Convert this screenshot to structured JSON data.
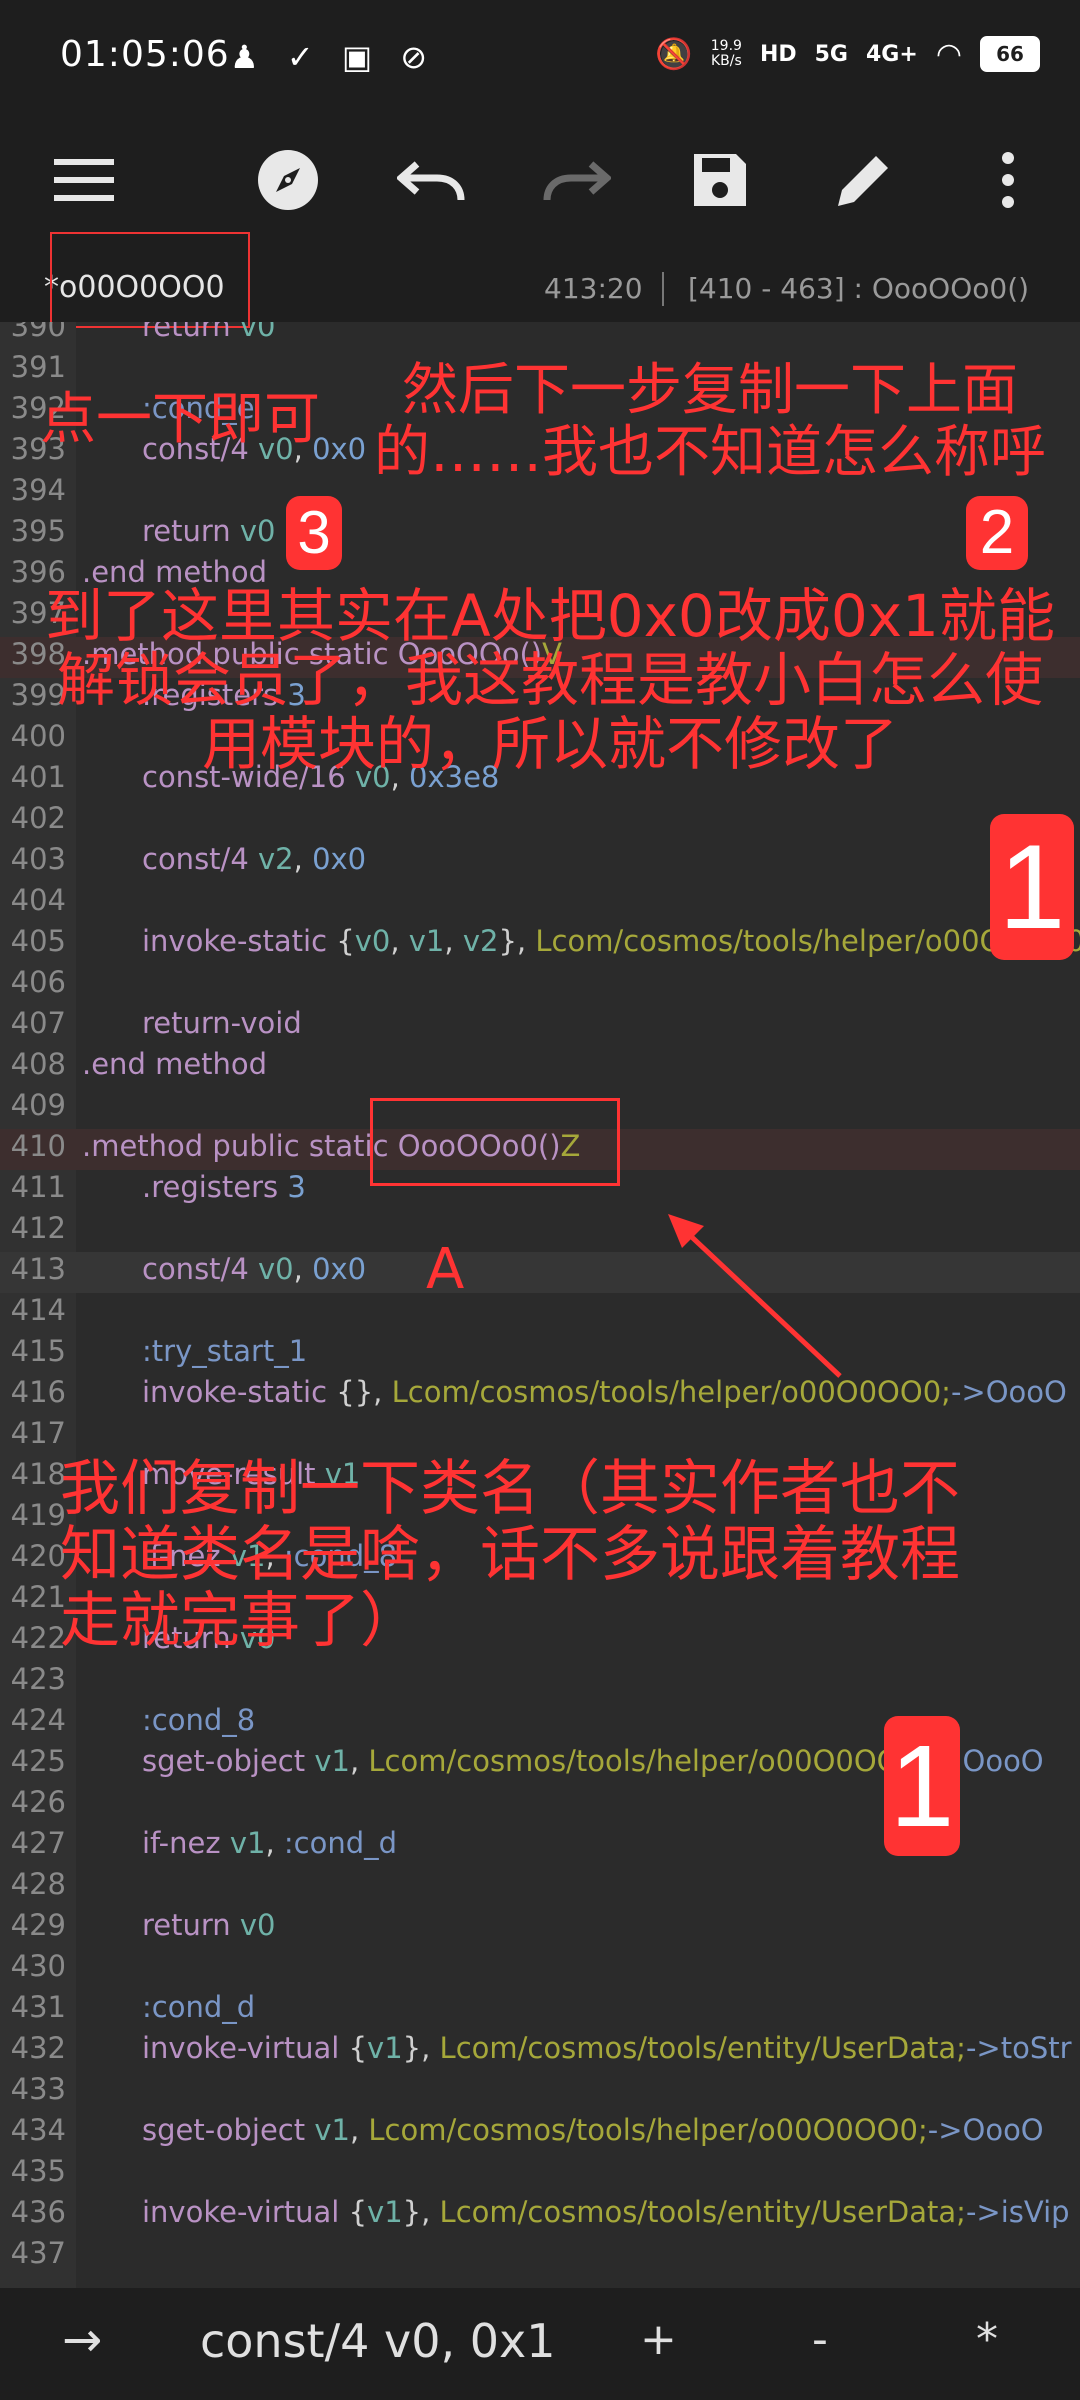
{
  "statusbar": {
    "time": "01:05:06",
    "net_speed_top": "19.9",
    "net_speed_unit": "KB/s",
    "hd": "HD",
    "sig1": "5G",
    "sig2": "4G+",
    "battery": "66"
  },
  "toolbar": {
    "menu_icon": "menu-icon",
    "compass_icon": "compass-icon",
    "undo_icon": "undo-icon",
    "redo_icon": "redo-icon",
    "save_icon": "save-icon",
    "edit_icon": "pencil-icon",
    "more_icon": "more-vertical-icon"
  },
  "filebar": {
    "filename": "*o00O0OO0",
    "cursor": "413:20",
    "range": "[410 - 463] : OooOOo0()"
  },
  "lines": [
    {
      "n": "390",
      "t": [
        [
          "kw",
          "return"
        ],
        [
          "",
          "  "
        ],
        [
          "reg",
          "v0"
        ]
      ]
    },
    {
      "n": "391",
      "t": []
    },
    {
      "n": "392",
      "t": [
        [
          "lbl",
          ":cond_e"
        ]
      ]
    },
    {
      "n": "393",
      "t": [
        [
          "kw",
          "const/4"
        ],
        [
          "",
          " "
        ],
        [
          "reg",
          "v0"
        ],
        [
          "",
          ", "
        ],
        [
          "lit",
          "0x0"
        ]
      ]
    },
    {
      "n": "394",
      "t": []
    },
    {
      "n": "395",
      "t": [
        [
          "kw",
          "return"
        ],
        [
          "",
          " "
        ],
        [
          "reg",
          "v0"
        ]
      ]
    },
    {
      "n": "396",
      "t": [
        [
          "dir",
          ".end method"
        ]
      ]
    },
    {
      "n": "397",
      "t": []
    },
    {
      "n": "398",
      "t": [
        [
          "dir",
          ".method public static OooOOo()"
        ],
        [
          "cls",
          "V"
        ]
      ]
    },
    {
      "n": "399",
      "t": [
        [
          "dir",
          ".registers"
        ],
        [
          "",
          " "
        ],
        [
          "lit",
          "3"
        ]
      ]
    },
    {
      "n": "400",
      "t": []
    },
    {
      "n": "401",
      "t": [
        [
          "kw",
          "const-wide/16"
        ],
        [
          "",
          " "
        ],
        [
          "reg",
          "v0"
        ],
        [
          "",
          ", "
        ],
        [
          "lit",
          "0x3e8"
        ]
      ]
    },
    {
      "n": "402",
      "t": []
    },
    {
      "n": "403",
      "t": [
        [
          "kw",
          "const/4"
        ],
        [
          "",
          " "
        ],
        [
          "reg",
          "v2"
        ],
        [
          "",
          ", "
        ],
        [
          "lit",
          "0x0"
        ]
      ]
    },
    {
      "n": "404",
      "t": []
    },
    {
      "n": "405",
      "t": [
        [
          "kw",
          "invoke-static"
        ],
        [
          "",
          " {"
        ],
        [
          "reg",
          "v0"
        ],
        [
          "",
          ", "
        ],
        [
          "reg",
          "v1"
        ],
        [
          "",
          ", "
        ],
        [
          "reg",
          "v2"
        ],
        [
          "",
          "}, "
        ],
        [
          "cls",
          "Lcom/cosmos/tools/helper/o00O0OO0"
        ]
      ]
    },
    {
      "n": "406",
      "t": []
    },
    {
      "n": "407",
      "t": [
        [
          "kw",
          "return-void"
        ]
      ]
    },
    {
      "n": "408",
      "t": [
        [
          "dir",
          ".end method"
        ]
      ]
    },
    {
      "n": "409",
      "t": []
    },
    {
      "n": "410",
      "t": [
        [
          "dir",
          ".method public static OooOOo0()"
        ],
        [
          "cls",
          "Z"
        ]
      ]
    },
    {
      "n": "411",
      "t": [
        [
          "dir",
          ".registers"
        ],
        [
          "",
          " "
        ],
        [
          "lit",
          "3"
        ]
      ]
    },
    {
      "n": "412",
      "t": []
    },
    {
      "n": "413",
      "t": [
        [
          "kw",
          "const/4"
        ],
        [
          "",
          " "
        ],
        [
          "reg",
          "v0"
        ],
        [
          "",
          ", "
        ],
        [
          "lit",
          "0x0"
        ]
      ]
    },
    {
      "n": "414",
      "t": []
    },
    {
      "n": "415",
      "t": [
        [
          "lbl",
          ":try_start_1"
        ]
      ]
    },
    {
      "n": "416",
      "t": [
        [
          "kw",
          "invoke-static"
        ],
        [
          "",
          " {}, "
        ],
        [
          "cls",
          "Lcom/cosmos/tools/helper/o00O0OO0;"
        ],
        [
          "lbl",
          "->OooO"
        ]
      ]
    },
    {
      "n": "417",
      "t": []
    },
    {
      "n": "418",
      "t": [
        [
          "kw",
          "move-result"
        ],
        [
          "",
          " "
        ],
        [
          "reg",
          "v1"
        ]
      ]
    },
    {
      "n": "419",
      "t": []
    },
    {
      "n": "420",
      "t": [
        [
          "kw",
          "if-nez"
        ],
        [
          "",
          " "
        ],
        [
          "reg",
          "v1"
        ],
        [
          "",
          ", "
        ],
        [
          "lbl",
          ":cond_8"
        ]
      ]
    },
    {
      "n": "421",
      "t": []
    },
    {
      "n": "422",
      "t": [
        [
          "kw",
          "return"
        ],
        [
          "",
          " "
        ],
        [
          "reg",
          "v0"
        ]
      ]
    },
    {
      "n": "423",
      "t": []
    },
    {
      "n": "424",
      "t": [
        [
          "lbl",
          ":cond_8"
        ]
      ]
    },
    {
      "n": "425",
      "t": [
        [
          "kw",
          "sget-object"
        ],
        [
          "",
          " "
        ],
        [
          "reg",
          "v1"
        ],
        [
          "",
          ", "
        ],
        [
          "cls",
          "Lcom/cosmos/tools/helper/o00O0OO0;"
        ],
        [
          "lbl",
          "->OooO"
        ]
      ]
    },
    {
      "n": "426",
      "t": []
    },
    {
      "n": "427",
      "t": [
        [
          "kw",
          "if-nez"
        ],
        [
          "",
          " "
        ],
        [
          "reg",
          "v1"
        ],
        [
          "",
          ", "
        ],
        [
          "lbl",
          ":cond_d"
        ]
      ]
    },
    {
      "n": "428",
      "t": []
    },
    {
      "n": "429",
      "t": [
        [
          "kw",
          "return"
        ],
        [
          "",
          " "
        ],
        [
          "reg",
          "v0"
        ]
      ]
    },
    {
      "n": "430",
      "t": []
    },
    {
      "n": "431",
      "t": [
        [
          "lbl",
          ":cond_d"
        ]
      ]
    },
    {
      "n": "432",
      "t": [
        [
          "kw",
          "invoke-virtual"
        ],
        [
          "",
          " {"
        ],
        [
          "reg",
          "v1"
        ],
        [
          "",
          "}, "
        ],
        [
          "cls",
          "Lcom/cosmos/tools/entity/UserData;"
        ],
        [
          "lbl",
          "->toStr"
        ]
      ]
    },
    {
      "n": "433",
      "t": []
    },
    {
      "n": "434",
      "t": [
        [
          "kw",
          "sget-object"
        ],
        [
          "",
          " "
        ],
        [
          "reg",
          "v1"
        ],
        [
          "",
          ", "
        ],
        [
          "cls",
          "Lcom/cosmos/tools/helper/o00O0OO0;"
        ],
        [
          "lbl",
          "->OooO"
        ]
      ]
    },
    {
      "n": "435",
      "t": []
    },
    {
      "n": "436",
      "t": [
        [
          "kw",
          "invoke-virtual"
        ],
        [
          "",
          " {"
        ],
        [
          "reg",
          "v1"
        ],
        [
          "",
          "}, "
        ],
        [
          "cls",
          "Lcom/cosmos/tools/entity/UserData;"
        ],
        [
          "lbl",
          "->isVip"
        ]
      ]
    },
    {
      "n": "437",
      "t": []
    }
  ],
  "annotations": {
    "tap_once": "点一下即可",
    "next_copy": "然后下一步复制一下上面的……我也不知道怎么称呼",
    "at_a": "到了这里其实在A处把0x0改成0x1就能解锁会员了，我这教程是教小白怎么使用模块的，所以就不修改了",
    "copy_class": "我们复制一下类名（其实作者也不知道类名是啥，话不多说跟着教程走就完事了）",
    "label_a": "A",
    "badge_3": "3",
    "badge_2": "2",
    "badge_1a": "1",
    "badge_1b": "1"
  },
  "colors": {
    "annotation": "#ff3333"
  },
  "bottombar": {
    "arrow": "→",
    "input": "const/4 v0, 0x1",
    "plus": "+",
    "minus": "-",
    "star": "*"
  }
}
